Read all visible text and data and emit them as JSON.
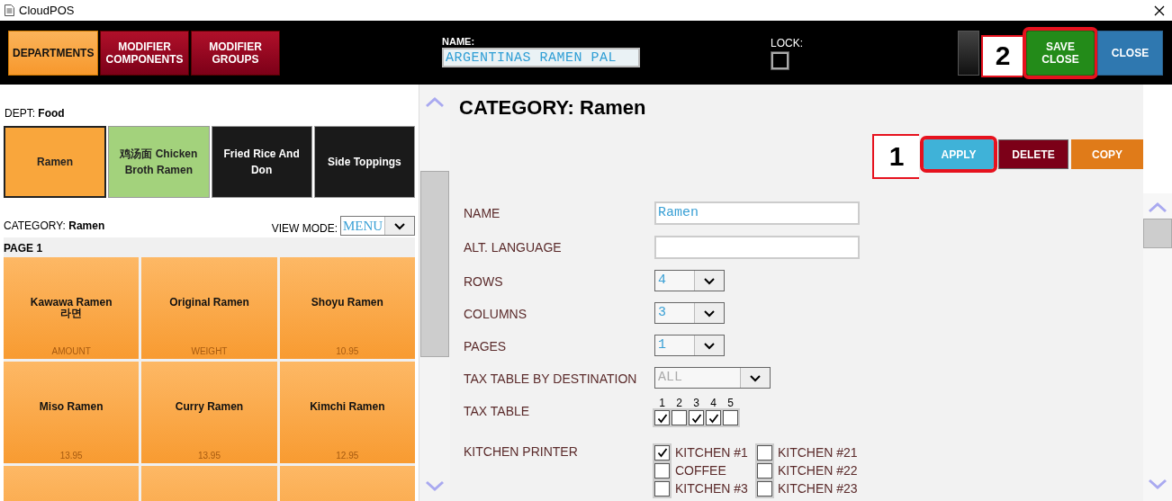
{
  "window": {
    "title": "CloudPOS"
  },
  "toolbar": {
    "tabs": [
      {
        "label": "DEPARTMENTS",
        "selected": true
      },
      {
        "label": "MODIFIER COMPONENTS",
        "selected": false
      },
      {
        "label": "MODIFIER GROUPS",
        "selected": false
      }
    ],
    "name_field": {
      "label": "NAME:",
      "value": "ARGENTINAS RAMEN PAL"
    },
    "lock": {
      "label": "LOCK:",
      "checked": false
    },
    "actions": [
      {
        "kind": "dark",
        "highlighted": false
      },
      {
        "kind": "save",
        "label": "SAVE CLOSE",
        "highlighted": true,
        "marker": "2"
      },
      {
        "kind": "close",
        "label": "CLOSE",
        "highlighted": false
      }
    ]
  },
  "left": {
    "dept_label": "DEPT:",
    "dept": "Food",
    "departments": [
      {
        "label": "Ramen",
        "color": "#f9a63c",
        "selected": true
      },
      {
        "label": "鸡汤面 Chicken Broth Ramen",
        "color": "#a3d27c",
        "selected": false
      },
      {
        "label": "Fried Rice And Don",
        "color": "#1a1a1a",
        "selected": false
      },
      {
        "label": "Side Toppings",
        "color": "#1a1a1a",
        "selected": false
      }
    ],
    "category_label": "CATEGORY:",
    "category": "Ramen",
    "view_mode": {
      "label": "VIEW MODE:",
      "value": "MENU"
    },
    "page": "PAGE 1",
    "items": [
      {
        "kind": "item",
        "name": "Kawawa Ramen",
        "sub": "라면",
        "price": "AMOUNT"
      },
      {
        "kind": "item",
        "name": "Original Ramen",
        "price": "WEIGHT"
      },
      {
        "kind": "item",
        "name": "Shoyu Ramen",
        "price": "10.95"
      },
      {
        "kind": "item",
        "name": "Miso Ramen",
        "price": "13.95"
      },
      {
        "kind": "item",
        "name": "Curry Ramen",
        "price": "13.95"
      },
      {
        "kind": "item",
        "name": "Kimchi Ramen",
        "price": "12.95"
      },
      {
        "kind": "empty"
      },
      {
        "kind": "empty"
      },
      {
        "kind": "empty"
      }
    ]
  },
  "right": {
    "title": "CATEGORY: Ramen",
    "buttons": [
      {
        "kind": "apply",
        "label": "APPLY",
        "highlighted": true,
        "marker": "1"
      },
      {
        "kind": "delete",
        "label": "DELETE",
        "highlighted": false
      },
      {
        "kind": "copy",
        "label": "COPY",
        "highlighted": false
      }
    ],
    "fields": [
      {
        "kind": "text",
        "label": "NAME",
        "value": "Ramen"
      },
      {
        "kind": "text",
        "label": "ALT. LANGUAGE"
      },
      {
        "kind": "select",
        "label": "ROWS",
        "value": "4",
        "disabled": false
      },
      {
        "kind": "select",
        "label": "COLUMNS",
        "value": "3",
        "disabled": false
      },
      {
        "kind": "select",
        "label": "PAGES",
        "value": "1",
        "disabled": false
      },
      {
        "kind": "select",
        "label": "TAX TABLE BY DESTINATION",
        "value": "ALL",
        "disabled": true
      },
      {
        "kind": "taxes",
        "label": "TAX TABLE",
        "options": [
          {
            "label": "1",
            "checked": true
          },
          {
            "label": "2",
            "checked": false
          },
          {
            "label": "3",
            "checked": true
          },
          {
            "label": "4",
            "checked": true
          },
          {
            "label": "5",
            "checked": false
          }
        ]
      },
      {
        "kind": "printers",
        "label": "KITCHEN PRINTER",
        "options": [
          {
            "label": "KITCHEN #1",
            "checked": true
          },
          {
            "label": "COFFEE",
            "checked": false
          },
          {
            "label": "KITCHEN #3",
            "checked": false
          },
          {
            "label": "KITCHEN #21",
            "checked": false
          },
          {
            "label": "KITCHEN #22",
            "checked": false
          },
          {
            "label": "KITCHEN #23",
            "checked": false
          }
        ]
      }
    ]
  }
}
